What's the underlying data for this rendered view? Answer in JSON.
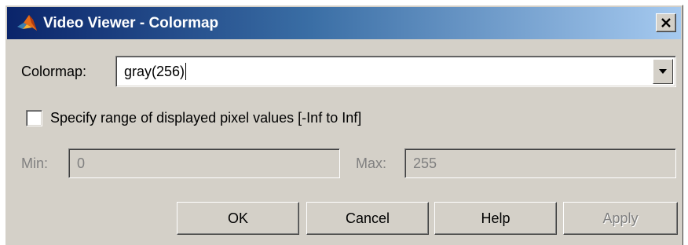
{
  "window": {
    "title": "Video Viewer - Colormap",
    "close_glyph": "✕",
    "icon": "matlab-logo-icon"
  },
  "colormap": {
    "label": "Colormap:",
    "value": "gray(256)"
  },
  "range": {
    "checkbox_label": "Specify range of displayed pixel values [-Inf to Inf]",
    "checked": false,
    "min_label": "Min:",
    "min_value": "0",
    "max_label": "Max:",
    "max_value": "255"
  },
  "buttons": {
    "ok": "OK",
    "cancel": "Cancel",
    "help": "Help",
    "apply": "Apply"
  },
  "colors": {
    "dialog_bg": "#d4d0c8",
    "title_gradient_start": "#0a246a",
    "title_gradient_end": "#a6caf0",
    "disabled_text": "#808080"
  }
}
